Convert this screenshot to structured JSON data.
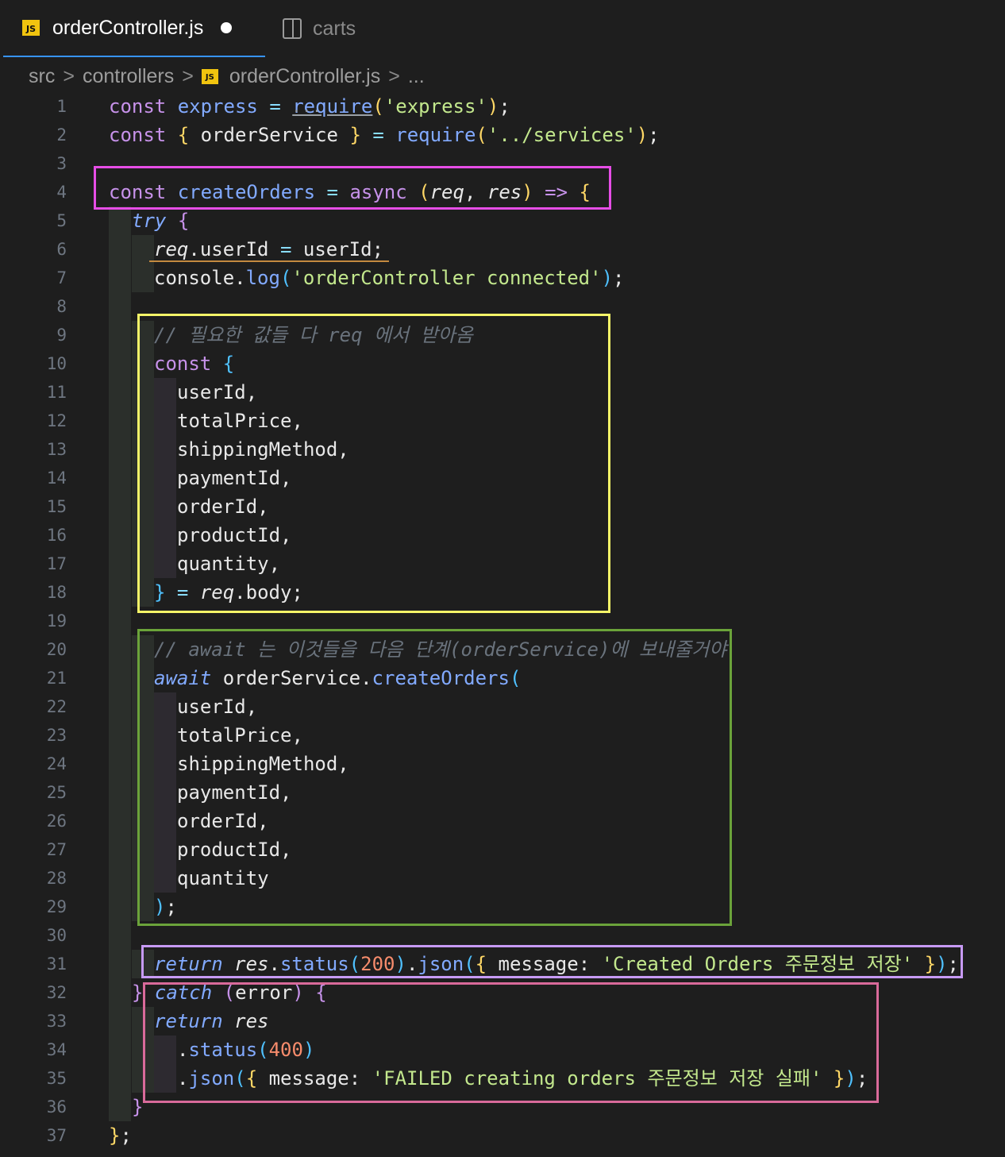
{
  "tabs": [
    {
      "label": "orderController.js",
      "icon": "js-file-icon",
      "modified": true,
      "active": true
    },
    {
      "label": "carts",
      "icon": "split-editor-icon",
      "active": false
    }
  ],
  "breadcrumb": {
    "items": [
      "src",
      "controllers",
      "orderController.js",
      "..."
    ],
    "separator": ">"
  },
  "editor": {
    "lines": [
      {
        "n": "1"
      },
      {
        "n": "2"
      },
      {
        "n": "3"
      },
      {
        "n": "4"
      },
      {
        "n": "5"
      },
      {
        "n": "6"
      },
      {
        "n": "7"
      },
      {
        "n": "8"
      },
      {
        "n": "9"
      },
      {
        "n": "10"
      },
      {
        "n": "11"
      },
      {
        "n": "12"
      },
      {
        "n": "13"
      },
      {
        "n": "14"
      },
      {
        "n": "15"
      },
      {
        "n": "16"
      },
      {
        "n": "17"
      },
      {
        "n": "18"
      },
      {
        "n": "19"
      },
      {
        "n": "20"
      },
      {
        "n": "21"
      },
      {
        "n": "22"
      },
      {
        "n": "23"
      },
      {
        "n": "24"
      },
      {
        "n": "25"
      },
      {
        "n": "26"
      },
      {
        "n": "27"
      },
      {
        "n": "28"
      },
      {
        "n": "29"
      },
      {
        "n": "30"
      },
      {
        "n": "31"
      },
      {
        "n": "32"
      },
      {
        "n": "33"
      },
      {
        "n": "34"
      },
      {
        "n": "35"
      },
      {
        "n": "36"
      },
      {
        "n": "37"
      }
    ],
    "tokens": {
      "const": "const",
      "express": "express",
      "eq": "=",
      "require": "require",
      "lp": "(",
      "rp": ")",
      "semi": ";",
      "str_express": "'express'",
      "lb": "{",
      "rb": "}",
      "orderService": "orderService",
      "str_services": "'../services'",
      "createOrders": "createOrders",
      "async": "async",
      "req": "req",
      "comma": ",",
      "res": "res",
      "arrow": "=>",
      "try": "try",
      "dot": ".",
      "userId": "userId",
      "console": "console",
      "log": "log",
      "str_connected": "'orderController connected'",
      "comment1": "// 필요한 값들 다 req 에서 받아옴",
      "totalPrice": "totalPrice",
      "shippingMethod": "shippingMethod",
      "paymentId": "paymentId",
      "orderId": "orderId",
      "productId": "productId",
      "quantity": "quantity",
      "body": "body",
      "comment2": "// await 는 이것들을 다음 단계(orderService)에 보내줄거야",
      "await": "await",
      "return": "return",
      "status": "status",
      "n200": "200",
      "json": "json",
      "message": "message",
      "colon": ":",
      "str_created": "'Created Orders 주문정보 저장'",
      "catch": "catch",
      "error": "error",
      "n400": "400",
      "str_failed": "'FAILED creating orders 주문정보 저장 실패'"
    }
  },
  "colors": {
    "background": "#1e1e1e",
    "box_magenta": "#e64de6",
    "box_yellow": "#f5f568",
    "box_green": "#6ba33a",
    "box_violet": "#c79af5",
    "box_pink": "#d96a9a"
  }
}
